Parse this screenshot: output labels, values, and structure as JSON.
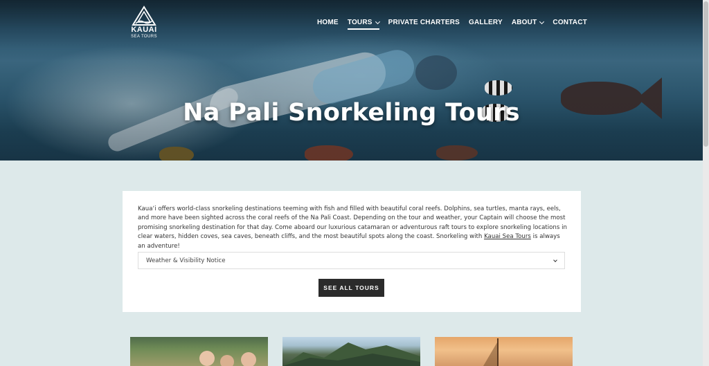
{
  "brand": {
    "name": "KAUAI",
    "subtitle": "SEA TOURS"
  },
  "nav": {
    "items": [
      {
        "label": "HOME",
        "dropdown": false,
        "active": false
      },
      {
        "label": "TOURS",
        "dropdown": true,
        "active": true
      },
      {
        "label": "PRIVATE CHARTERS",
        "dropdown": false,
        "active": false
      },
      {
        "label": "GALLERY",
        "dropdown": false,
        "active": false
      },
      {
        "label": "ABOUT",
        "dropdown": true,
        "active": false
      },
      {
        "label": "CONTACT",
        "dropdown": false,
        "active": false
      }
    ]
  },
  "hero": {
    "title": "Na Pali Snorkeling Tours"
  },
  "intro": {
    "text_before_link": "Kaua‘i offers world-class snorkeling destinations teeming with fish and filled with beautiful coral reefs. Dolphins, sea turtles, manta rays, eels, and more have been sighted across the coral reefs of the Na Pali Coast. Depending on the tour and weather, your Captain will choose the most promising snorkeling destination for that day. Come aboard our luxurious catamaran or adventurous raft tours to explore snorkeling locations in clear waters, hidden coves, sea caves, beneath cliffs, and the most beautiful spots along the coast. Snorkeling with ",
    "link_text": "Kauai Sea Tours",
    "text_after_link": " is always an adventure!"
  },
  "accordion": {
    "label": "Weather & Visibility Notice"
  },
  "cta": {
    "label": "SEE ALL TOURS"
  },
  "colors": {
    "page_background": "#dde9ea",
    "card_background": "#ffffff",
    "button_background": "#2b2b2b",
    "nav_text": "#ffffff"
  }
}
